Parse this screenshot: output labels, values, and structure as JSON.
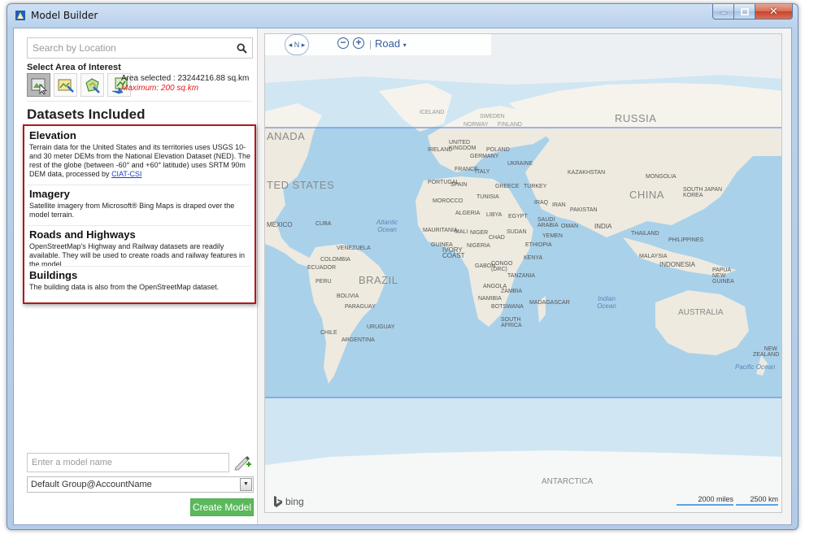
{
  "window": {
    "title": "Model Builder"
  },
  "search": {
    "placeholder": "Search by Location"
  },
  "area_of_interest": {
    "label": "Select Area of Interest",
    "area_selected": "Area selected : 23244216.88 sq.km",
    "maximum": "Maximum: 200 sq.km"
  },
  "datasets": {
    "title": "Datasets Included",
    "items": [
      {
        "name": "Elevation",
        "description": "Terrain data for the United States and its territories uses USGS 10- and 30 meter DEMs from the National Elevation Dataset (NED). The rest of the globe (between -60° and +60° latitude) uses SRTM 90m DEM data, processed by ",
        "link": "CIAT-CSI"
      },
      {
        "name": "Imagery",
        "description": "Satellite imagery from Microsoft® Bing Maps is draped over the model terrain."
      },
      {
        "name": "Roads and Highways",
        "description": "OpenStreetMap's Highway and Railway datasets are readily available. They will be used to create roads and railway features in the model."
      },
      {
        "name": "Buildings",
        "description": "The building data is also from the OpenStreetMap dataset."
      }
    ]
  },
  "model": {
    "name_placeholder": "Enter a model name",
    "group_selected": "Default Group@AccountName",
    "create_label": "Create Model"
  },
  "map": {
    "compass_label": "N",
    "map_style": "Road",
    "provider": "bing",
    "scale_miles": "2000 miles",
    "scale_km": "2500 km",
    "labels": {
      "russia": "RUSSIA",
      "canada": "ANADA",
      "usa": "TED STATES",
      "china": "CHINA",
      "brazil": "BRAZIL",
      "australia": "AUSTRALIA",
      "antarctica": "ANTARCTICA",
      "mexico": "MEXICO",
      "india": "INDIA",
      "kazakhstan": "KAZAKHSTAN",
      "mongolia": "MONGOLIA",
      "atlantic": "Atlantic Ocean",
      "indian": "Indian Ocean",
      "pacific": "Pacific Ocean",
      "argentina": "ARGENTINA",
      "peru": "PERU",
      "chile": "CHILE",
      "algeria": "ALGERIA",
      "libya": "LIBYA",
      "egypt": "EGYPT",
      "sudan": "SUDAN",
      "niger": "NIGER",
      "mali": "MALI",
      "chad": "CHAD",
      "nigeria": "NIGERIA",
      "ethiopia": "ETHIOPIA",
      "kenya": "KENYA",
      "congo": "CONGO (DRC)",
      "tanzania": "TANZANIA",
      "angola": "ANGOLA",
      "zambia": "ZAMBIA",
      "namibia": "NAMIBIA",
      "botswana": "BOTSWANA",
      "south_africa": "SOUTH AFRICA",
      "madagascar": "MADAGASCAR",
      "saudi": "SAUDI ARABIA",
      "iran": "IRAN",
      "iraq": "IRAQ",
      "turkey": "TURKEY",
      "pakistan": "PAKISTAN",
      "thailand": "THAILAND",
      "philippines": "PHILIPPINES",
      "malaysia": "MALAYSIA",
      "indonesia": "INDONESIA",
      "png": "PAPUA NEW GUINEA",
      "south_korea": "SOUTH KOREA",
      "japan": "JAPAN",
      "nz": "NEW ZEALAND",
      "uk": "UNITED KINGDOM",
      "ireland": "IRELAND",
      "france": "FRANCE",
      "spain": "SPAIN",
      "portugal": "PORTUGAL",
      "italy": "ITALY",
      "germany": "GERMANY",
      "poland": "POLAND",
      "ukraine": "UKRAINE",
      "greece": "GREECE",
      "norway": "NORWAY",
      "sweden": "SWEDEN",
      "finland": "FINLAND",
      "iceland": "ICELAND",
      "morocco": "MOROCCO",
      "tunisia": "TUNISIA",
      "mauritania": "MAURITANIA",
      "guinea": "GUINEA",
      "ivory": "IVORY COAST",
      "gabon": "GABON",
      "yemen": "YEMEN",
      "oman": "OMAN",
      "venezuela": "VENEZUELA",
      "colombia": "COLOMBIA",
      "ecuador": "ECUADOR",
      "bolivia": "BOLIVIA",
      "paraguay": "PARAGUAY",
      "uruguay": "URUGUAY",
      "cuba": "CUBA"
    }
  },
  "colors": {
    "accent_red": "#b1191d",
    "create_green": "#5cb85c",
    "link_blue": "#1a40c0",
    "selection_line": "#6a8fe6"
  }
}
